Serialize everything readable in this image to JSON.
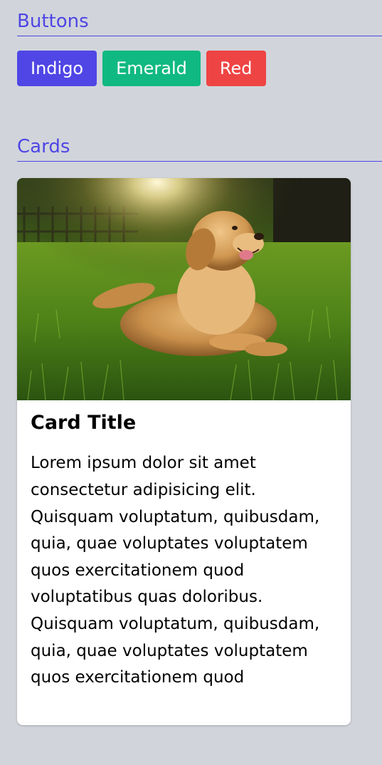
{
  "sections": {
    "buttons_heading": "Buttons",
    "cards_heading": "Cards"
  },
  "buttons": [
    {
      "label": "Indigo",
      "color": "#4f46e5"
    },
    {
      "label": "Emerald",
      "color": "#10b981"
    },
    {
      "label": "Red",
      "color": "#ef4444"
    }
  ],
  "card": {
    "image_icon": "dog-in-grass-photo",
    "title": "Card Title",
    "text": "Lorem ipsum dolor sit amet consectetur adipisicing elit. Quisquam voluptatum, quibusdam, quia, quae voluptates voluptatem quos exercitationem quod voluptatibus quas doloribus. Quisquam voluptatum, quibusdam, quia, quae voluptates voluptatem quos exercitationem quod"
  },
  "colors": {
    "background": "#d1d5db",
    "accent": "#4f46e5"
  }
}
